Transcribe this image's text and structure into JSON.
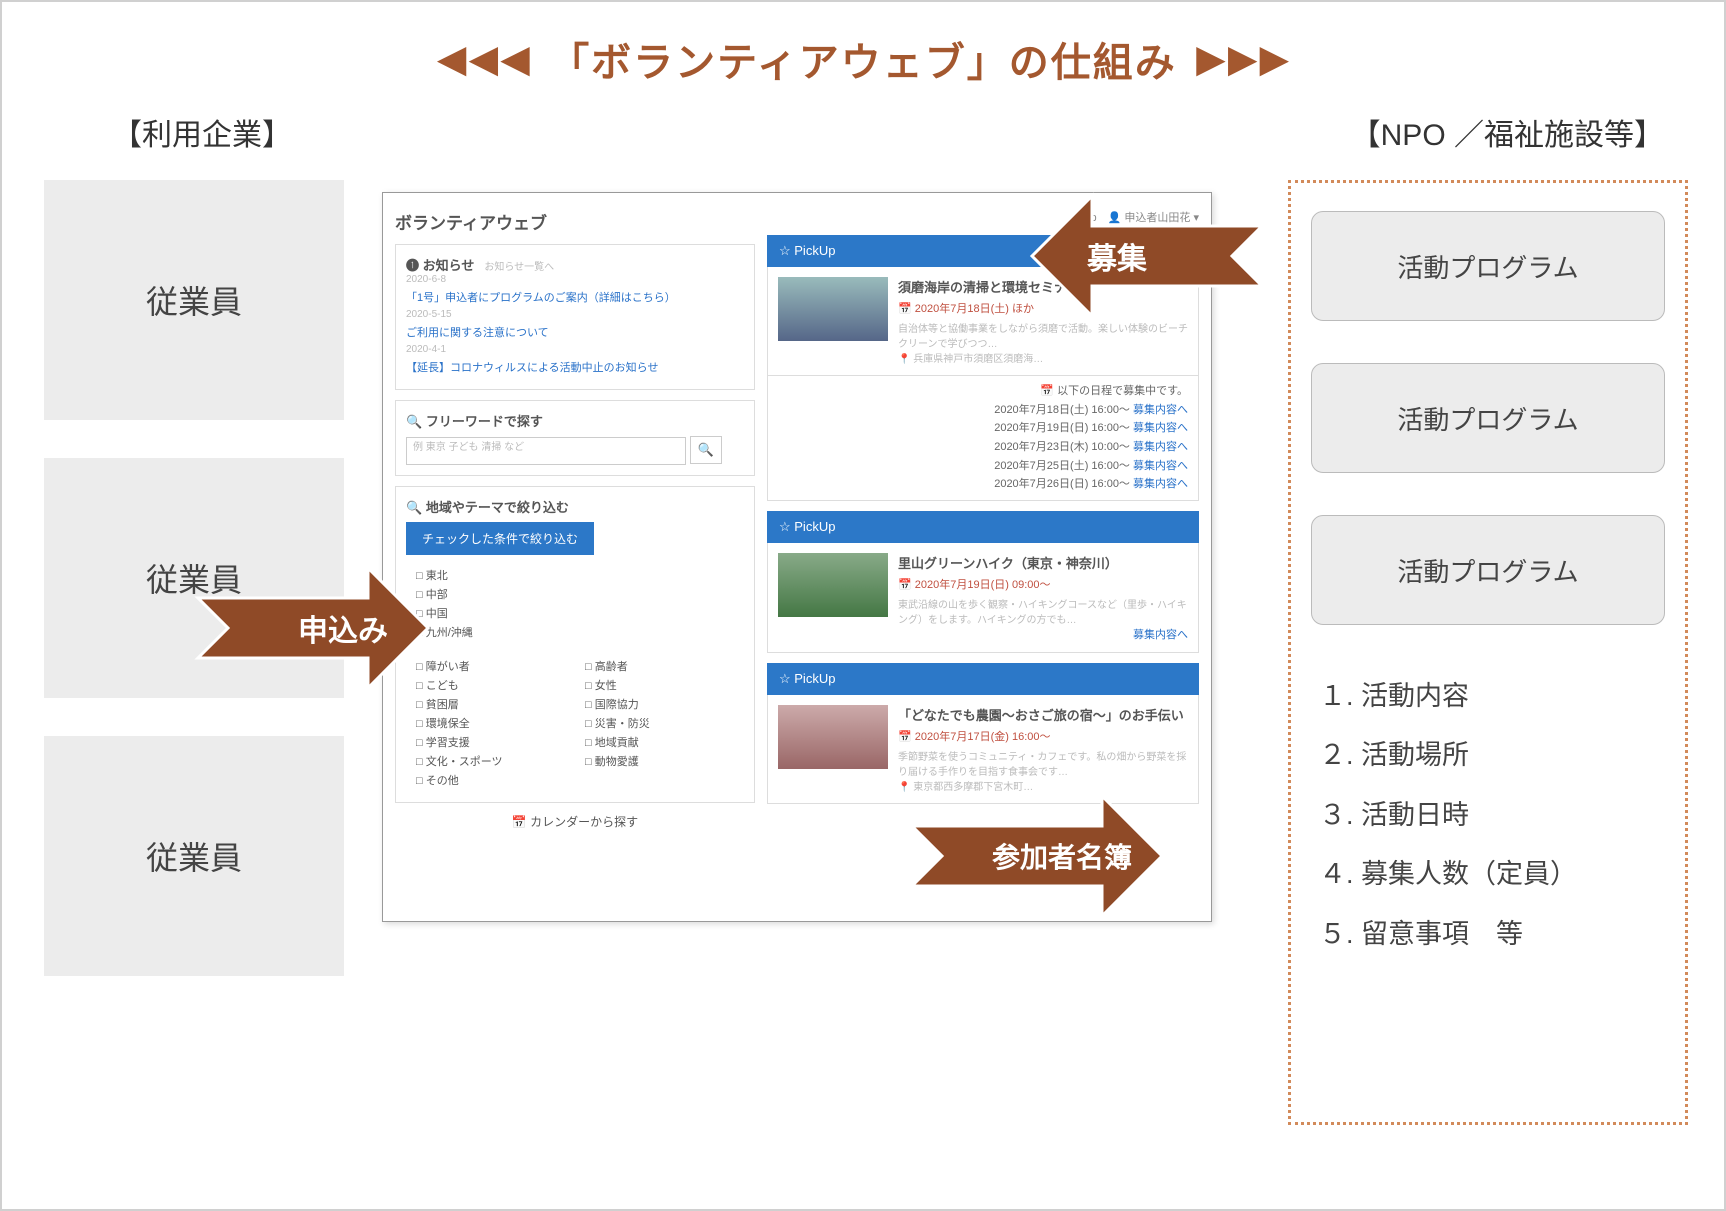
{
  "title": {
    "text": "「ボランティアウェブ」の仕組み"
  },
  "columns": {
    "left_header": "【利用企業】",
    "right_header": "【NPO ／福祉施設等】"
  },
  "employees": {
    "label": "従業員"
  },
  "npo": {
    "program_label": "活動プログラム",
    "list": {
      "i1": "１. 活動内容",
      "i2": "２. 活動場所",
      "i3": "３. 活動日時",
      "i4": "４. 募集人数（定員）",
      "i5": "５. 留意事項　等"
    }
  },
  "arrows": {
    "recruit": "募集",
    "apply": "申込み",
    "roster": "参加者名簿"
  },
  "app": {
    "brand": "ボランティアウェブ",
    "user": "申込者山田花",
    "news_header": "❶ お知らせ",
    "news_more": "お知らせ一覧へ",
    "news": {
      "n1": "「1号」申込者にプログラムのご案内（詳細はこちら）",
      "n2": "ご利用に関する注意について",
      "n3": "【延長】コロナウィルスによる活動中止のお知らせ"
    },
    "freeword_header": "フリーワードで探す",
    "freeword_placeholder": "例 東京 子ども 清掃 など",
    "refine_header": "地域やテーマで絞り込む",
    "refine_button": "チェックした条件で絞り込む",
    "region_checks": {
      "r1": "□ 東北",
      "r2": "□ 中部",
      "r3": "□ 中国",
      "r4": "□ 九州/沖縄"
    },
    "theme_checks": {
      "t1": "□ 障がい者",
      "t2": "□ 高齢者",
      "t3": "□ こども",
      "t4": "□ 女性",
      "t5": "□ 貧困層",
      "t6": "□ 国際協力",
      "t7": "□ 環境保全",
      "t8": "□ 災害・防災",
      "t9": "□ 学習支援",
      "t10": "□ 地域貢献",
      "t11": "□ 文化・スポーツ",
      "t12": "□ 動物愛護",
      "t13": "□ その他"
    },
    "calendar_link": "カレンダーから探す",
    "pickup_label": "☆ PickUp",
    "card1": {
      "title": "須磨海岸の清掃と環境セミナー",
      "date": "2020年7月18日(土) ほか",
      "desc": "自治体等と協働事業をしながら須磨で活動。楽しい体験のビーチクリーンで学びつつ…",
      "org": "兵庫県神戸市須磨区須磨海…"
    },
    "schedule_header": "以下の日程で募集中です。",
    "schedule": {
      "s1": "2020年7月18日(土) 16:00～",
      "s2": "2020年7月19日(日) 16:00～",
      "s3": "2020年7月23日(木) 10:00～",
      "s4": "2020年7月25日(土) 16:00～",
      "s5": "2020年7月26日(日) 16:00～",
      "detail": "募集内容へ"
    },
    "card2": {
      "title": "里山グリーンハイク（東京・神奈川）",
      "date": "2020年7月19日(日) 09:00～",
      "desc": "東武沿線の山を歩く観察・ハイキングコースなど（里歩・ハイキング）をします。ハイキングの方でも…",
      "link": "募集内容へ"
    },
    "card3": {
      "title": "「どなたでも農園〜おさご旅の宿〜」のお手伝い",
      "date": "2020年7月17日(金) 16:00～",
      "desc": "季節野菜を使うコミュニティ・カフェです。私の畑から野菜を採り届ける手作りを目指す食事会です…",
      "org": "東京都西多摩郡下宮木町…"
    }
  }
}
